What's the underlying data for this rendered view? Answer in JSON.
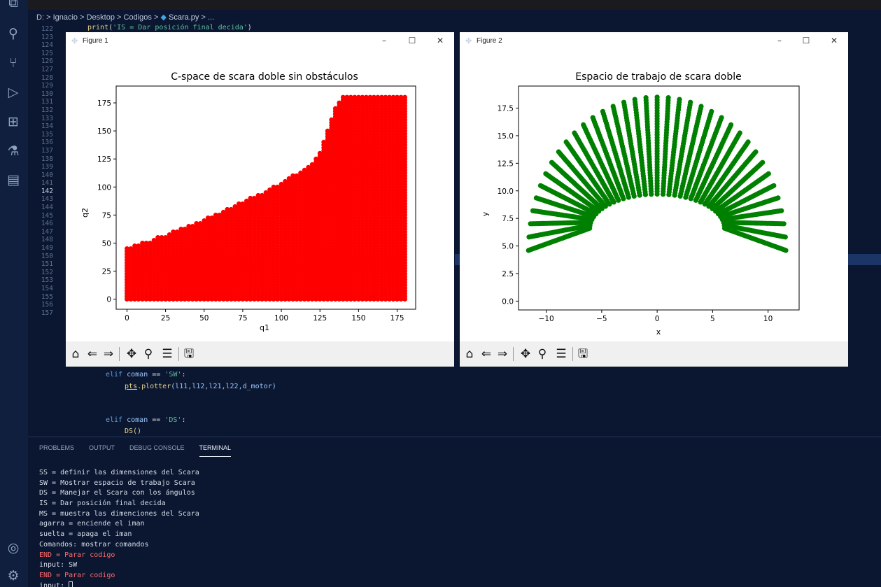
{
  "breadcrumb": {
    "drive": "D:",
    "user": "Ignacio",
    "desktop": "Desktop",
    "codigos": "Codigos",
    "file": "Scara.py",
    "more": "...",
    "sep": ">"
  },
  "editor": {
    "line_numbers": [
      "122",
      "123",
      "124",
      "125",
      "126",
      "127",
      "128",
      "129",
      "130",
      "131",
      "132",
      "133",
      "134",
      "135",
      "136",
      "137",
      "138",
      "139",
      "140",
      "141",
      "142",
      "143",
      "144",
      "145",
      "146",
      "147",
      "148",
      "149",
      "150",
      "151",
      "152",
      "153",
      "154",
      "155",
      "156",
      "157"
    ],
    "current_line": "142",
    "print_fn": "print",
    "print_str": "'IS = Dar posición final decida'",
    "elif_kw": "elif",
    "coman": "coman",
    "eqeq": "==",
    "sw_str": "'SW'",
    "ds_str": "'DS'",
    "pts": "pts",
    "plotter": ".plotter",
    "plotter_args": "(l11,l12,l21,l22,d_motor)",
    "ds_call": "DS()"
  },
  "panel": {
    "tabs": [
      "PROBLEMS",
      "OUTPUT",
      "DEBUG CONSOLE",
      "TERMINAL"
    ],
    "active_tab": "TERMINAL",
    "terminal_lines": [
      "SS = definir las dimensiones del Scara",
      "SW = Mostrar espacio de trabajo Scara",
      "DS = Manejar el Scara con los ángulos",
      "IS = Dar posición final decida",
      "MS = muestra las dimenciones del Scara",
      "agarra = enciende el iman",
      "suelta = apaga el iman",
      "Comandos: mostrar comandos",
      "END = Parar codigo",
      "input: SW",
      "END = Parar codigo",
      "input: "
    ],
    "red_lines": [
      8,
      10
    ]
  },
  "figure1": {
    "window_title": "Figure 1",
    "min_glyph": "–",
    "max_glyph": "☐",
    "close_glyph": "✕",
    "accent_color": "#ff0000"
  },
  "figure2": {
    "window_title": "Figure 2",
    "min_glyph": "–",
    "max_glyph": "☐",
    "close_glyph": "✕",
    "accent_color": "#008000"
  },
  "toolbar_icons": [
    "home-icon",
    "back-icon",
    "forward-icon",
    "pan-icon",
    "zoom-icon",
    "configure-subplots-icon",
    "save-icon"
  ],
  "chart_data": [
    {
      "type": "scatter",
      "title": "C-space de scara doble sin obstáculos",
      "xlabel": "q1",
      "ylabel": "q2",
      "xlim": [
        -7,
        187
      ],
      "ylim": [
        -9,
        190
      ],
      "xticks": [
        0,
        25,
        50,
        75,
        100,
        125,
        150,
        175
      ],
      "yticks": [
        0,
        25,
        50,
        75,
        100,
        125,
        150,
        175
      ],
      "color": "#ff0000",
      "grid": false,
      "boundary": {
        "q1": [
          0,
          5,
          10,
          15,
          20,
          25,
          30,
          35,
          40,
          45,
          50,
          55,
          60,
          65,
          70,
          75,
          80,
          85,
          90,
          95,
          100,
          105,
          110,
          115,
          120,
          125,
          130,
          135,
          140,
          145,
          150,
          155,
          160,
          165,
          170,
          175,
          180
        ],
        "q2_max": [
          45,
          48,
          50,
          52,
          55,
          57,
          60,
          63,
          66,
          68,
          71,
          74,
          77,
          80,
          84,
          87,
          90,
          93,
          96,
          100,
          104,
          108,
          112,
          116,
          120,
          130,
          150,
          170,
          180,
          180,
          180,
          180,
          180,
          180,
          180,
          180,
          180
        ]
      }
    },
    {
      "type": "scatter",
      "title": "Espacio de trabajo de scara doble",
      "xlabel": "x",
      "ylabel": "y",
      "xlim": [
        -12.5,
        12.8
      ],
      "ylim": [
        -0.8,
        19.5
      ],
      "xticks": [
        -10,
        -5,
        0,
        5,
        10
      ],
      "yticks": [
        0.0,
        2.5,
        5.0,
        7.5,
        10.0,
        12.5,
        15.0,
        17.5
      ],
      "xtick_labels": [
        "−10",
        "−5",
        "0",
        "5",
        "10"
      ],
      "ytick_labels": [
        "0.0",
        "2.5",
        "5.0",
        "7.5",
        "10.0",
        "12.5",
        "15.0",
        "17.5"
      ],
      "color": "#008000",
      "grid": false,
      "arm_lengths": {
        "l1": 9.25,
        "l2": 9.25
      },
      "q1_range_deg": [
        0,
        180
      ],
      "q2_range_deg": [
        0,
        180
      ]
    }
  ]
}
